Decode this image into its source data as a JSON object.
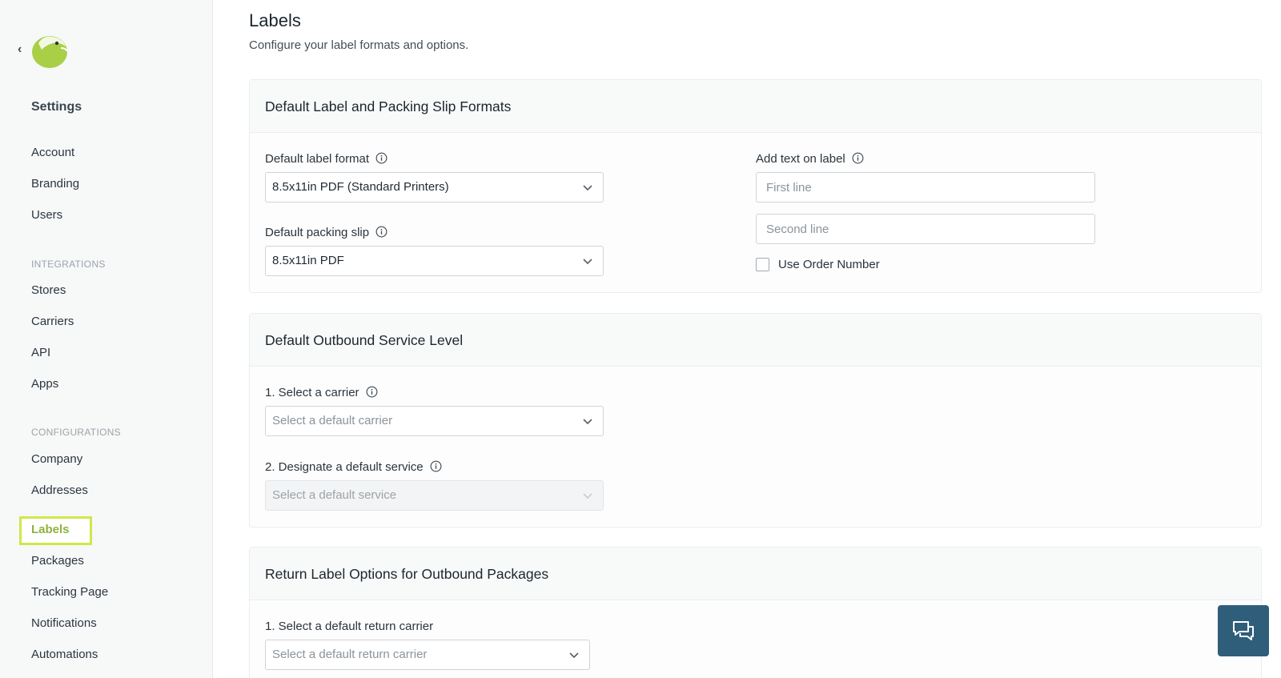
{
  "sidebar": {
    "back_glyph": "‹",
    "title": "Settings",
    "items_top": [
      {
        "label": "Account"
      },
      {
        "label": "Branding"
      },
      {
        "label": "Users"
      }
    ],
    "section_integrations": "INTEGRATIONS",
    "items_integrations": [
      {
        "label": "Stores"
      },
      {
        "label": "Carriers"
      },
      {
        "label": "API"
      },
      {
        "label": "Apps"
      }
    ],
    "section_configurations": "CONFIGURATIONS",
    "items_configurations": [
      {
        "label": "Company"
      },
      {
        "label": "Addresses"
      },
      {
        "label": "Labels",
        "active": true
      },
      {
        "label": "Packages"
      },
      {
        "label": "Tracking Page"
      },
      {
        "label": "Notifications"
      },
      {
        "label": "Automations"
      }
    ]
  },
  "page": {
    "title": "Labels",
    "subtitle": "Configure your label formats and options."
  },
  "formats_card": {
    "title": "Default Label and Packing Slip Formats",
    "label_format_label": "Default label format",
    "label_format_value": "8.5x11in PDF (Standard Printers)",
    "packing_slip_label": "Default packing slip",
    "packing_slip_value": "8.5x11in PDF",
    "add_text_label": "Add text on label",
    "first_line_placeholder": "First line",
    "second_line_placeholder": "Second line",
    "use_order_number_label": "Use Order Number"
  },
  "outbound_card": {
    "title": "Default Outbound Service Level",
    "carrier_label": "1. Select a carrier",
    "carrier_placeholder": "Select a default carrier",
    "service_label": "2. Designate a default service",
    "service_placeholder": "Select a default service"
  },
  "return_card": {
    "title": "Return Label Options for Outbound Packages",
    "return_carrier_label": "1. Select a default return carrier",
    "return_carrier_placeholder": "Select a default return carrier"
  },
  "icons": {
    "info": "info-icon",
    "chevron": "chevron-down-icon",
    "chat": "chat-icon",
    "logo": "logo-icon"
  },
  "colors": {
    "accent": "#cfe84a",
    "active_text": "#8fb23c",
    "chat_button": "#2f5e7a"
  }
}
